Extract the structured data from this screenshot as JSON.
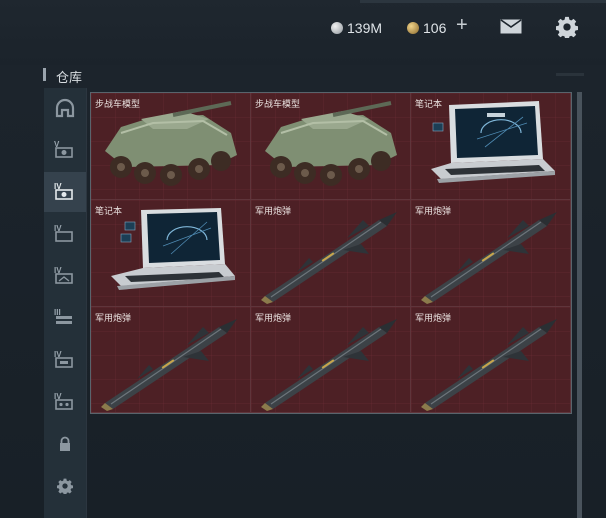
{
  "header": {
    "silver": "139M",
    "gold": "106",
    "plus": "+"
  },
  "panel": {
    "title": "仓库"
  },
  "sidebar": {
    "items": [
      {
        "name": "sidebar-item-all",
        "icon": "helmet-icon",
        "active": false
      },
      {
        "name": "sidebar-item-v",
        "icon": "tier-v-icon",
        "active": false
      },
      {
        "name": "sidebar-item-iv-a",
        "icon": "tier-iv-icon",
        "active": true
      },
      {
        "name": "sidebar-item-iv-b",
        "icon": "tier-iv-icon",
        "active": false
      },
      {
        "name": "sidebar-item-iv-c",
        "icon": "tier-iv-icon",
        "active": false
      },
      {
        "name": "sidebar-item-iii",
        "icon": "tier-iii-icon",
        "active": false
      },
      {
        "name": "sidebar-item-iv-d",
        "icon": "tier-iv-icon",
        "active": false
      },
      {
        "name": "sidebar-item-iv-e",
        "icon": "tier-iv-icon",
        "active": false
      },
      {
        "name": "sidebar-item-lock",
        "icon": "lock-icon",
        "active": false
      },
      {
        "name": "sidebar-item-settings",
        "icon": "gear-icon",
        "active": false
      }
    ]
  },
  "items": [
    {
      "label": "步战车模型",
      "type": "vehicle"
    },
    {
      "label": "步战车模型",
      "type": "vehicle"
    },
    {
      "label": "笔记本",
      "type": "laptop"
    },
    {
      "label": "笔记本",
      "type": "laptop"
    },
    {
      "label": "军用炮弹",
      "type": "missile"
    },
    {
      "label": "军用炮弹",
      "type": "missile"
    },
    {
      "label": "军用炮弹",
      "type": "missile"
    },
    {
      "label": "军用炮弹",
      "type": "missile"
    },
    {
      "label": "军用炮弹",
      "type": "missile"
    }
  ]
}
